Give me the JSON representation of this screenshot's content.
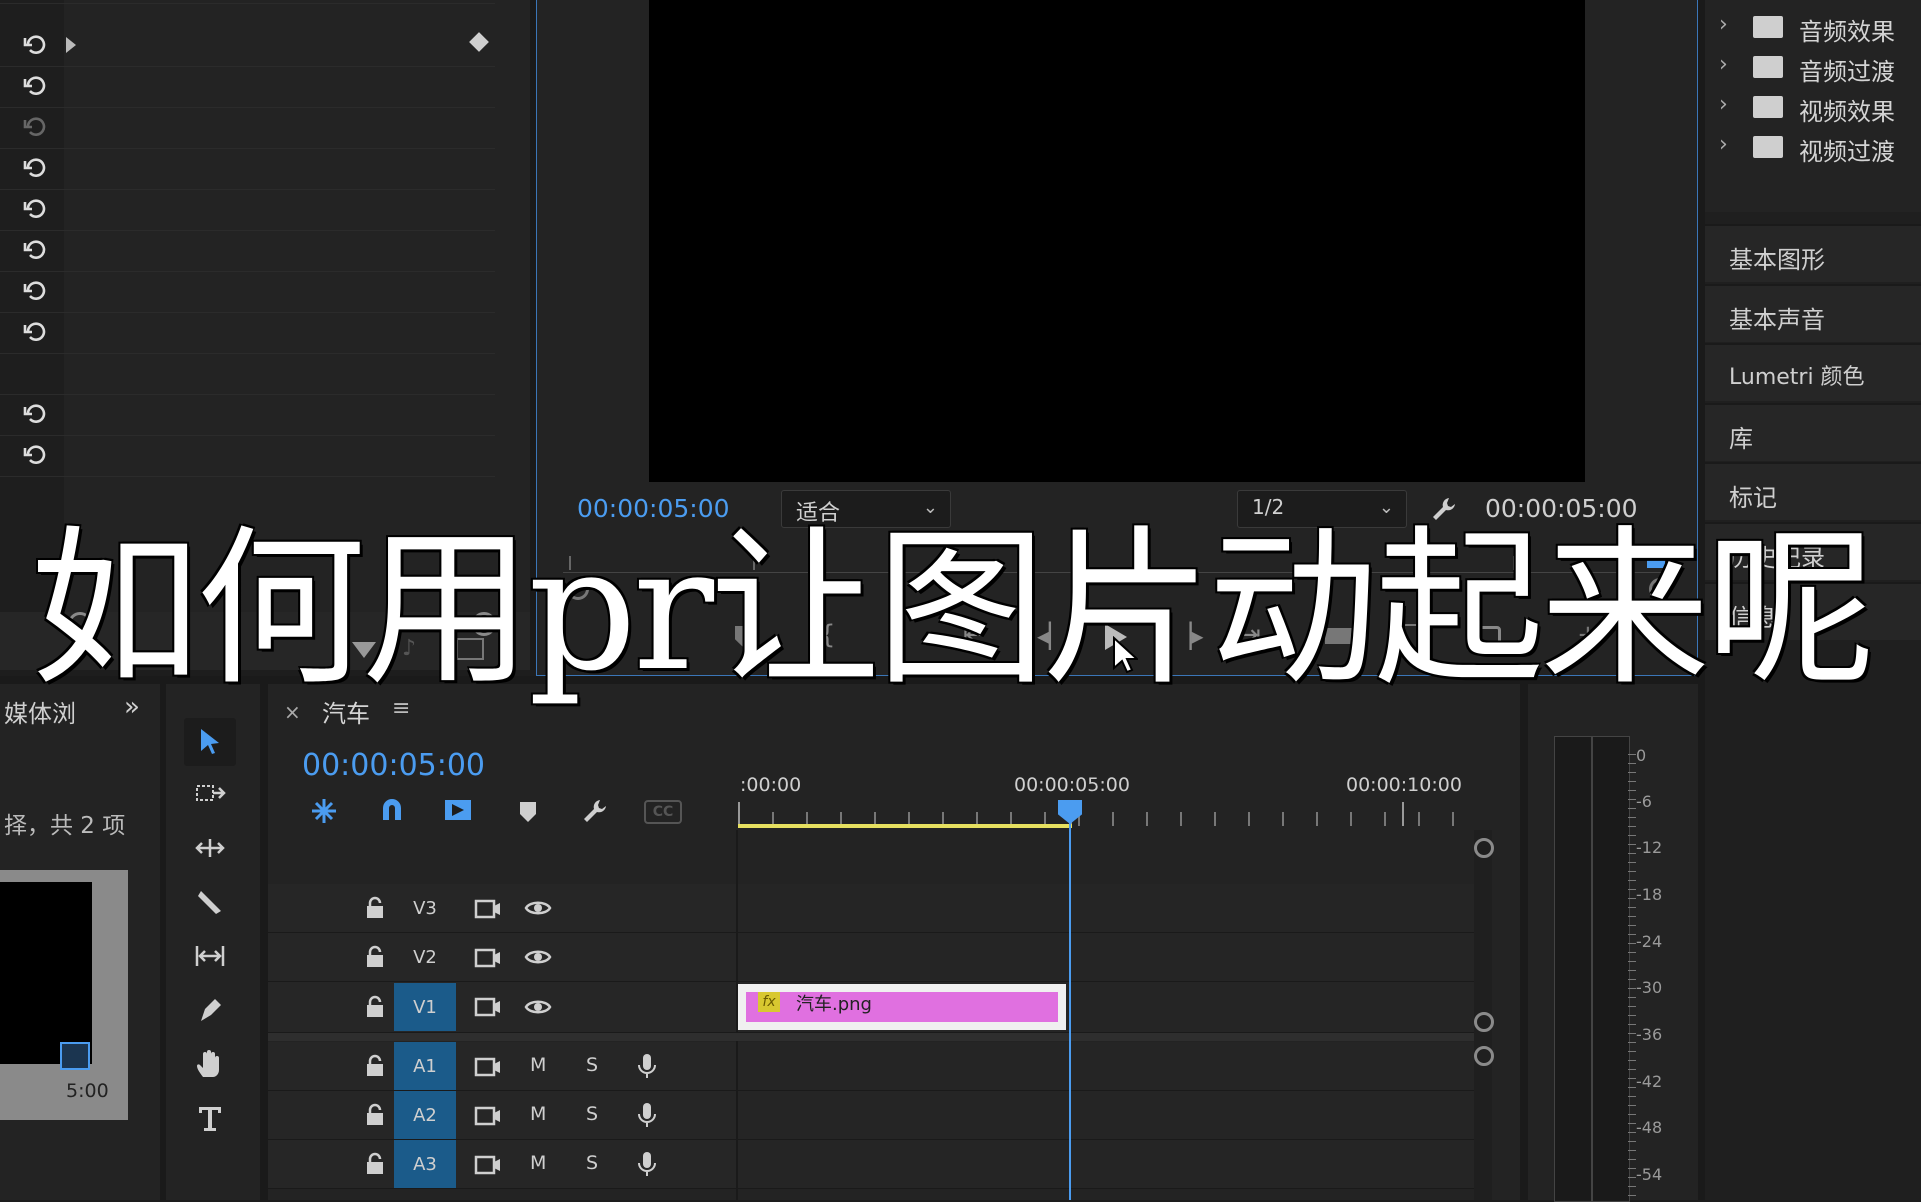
{
  "source_monitor": {
    "current_timecode": "00:00:05:00",
    "zoom_value": "适合",
    "resolution_value": "1/2",
    "duration_timecode": "00:00:05:00"
  },
  "effects_panel": {
    "folders": [
      "音频效果",
      "音频过渡",
      "视频效果",
      "视频过渡"
    ]
  },
  "right_panels": [
    "基本图形",
    "基本声音",
    "Lumetri 颜色",
    "库",
    "标记",
    "历史记录",
    "信息"
  ],
  "project_panel": {
    "title": "媒体浏",
    "selection_info": "择，共 2 项",
    "thumb_duration": "5:00"
  },
  "timeline": {
    "tab_title": "汽车",
    "close_glyph": "×",
    "menu_glyph": "≡",
    "current_timecode": "00:00:05:00",
    "ruler_labels": [
      ":00:00",
      "00:00:05:00",
      "00:00:10:00"
    ],
    "video_tracks": [
      "V3",
      "V2",
      "V1"
    ],
    "audio_tracks": [
      "A1",
      "A2",
      "A3"
    ],
    "mute_label": "M",
    "solo_label": "S",
    "clip": {
      "fx_badge": "fx",
      "name": "汽车.png",
      "color": "#e070e0"
    },
    "cc_label": "CC"
  },
  "audio_meter": {
    "db_labels": [
      "0",
      "-6",
      "-12",
      "-18",
      "-24",
      "-30",
      "-36",
      "-42",
      "-48",
      "-54"
    ]
  },
  "overlay": {
    "title": "如何用pr让图片动起来呢"
  },
  "colors": {
    "accent_blue": "#4b9cf0",
    "clip_pink": "#e070e0",
    "track_active": "#1b5b8a",
    "work_area_yellow": "#e6e060"
  }
}
